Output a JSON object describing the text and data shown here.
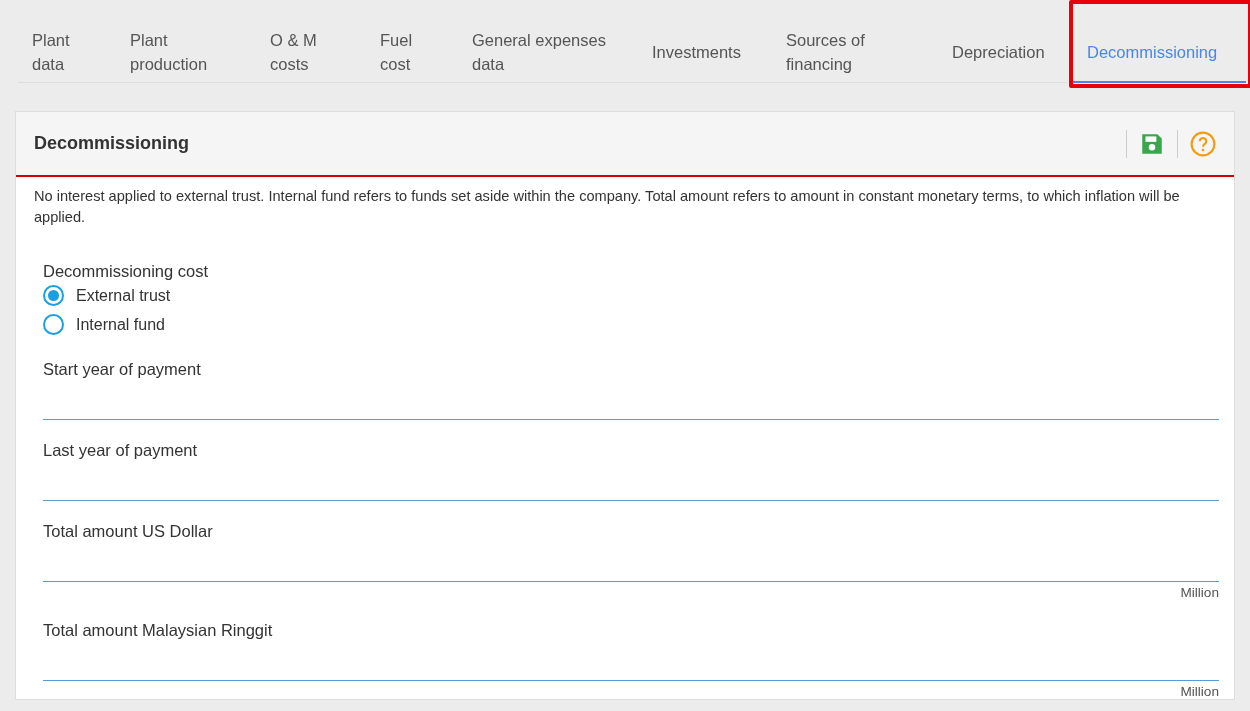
{
  "tabs": [
    {
      "label": "Plant data",
      "selected": false,
      "highlighted": false
    },
    {
      "label": "Plant production",
      "selected": false,
      "highlighted": false
    },
    {
      "label": "O & M costs",
      "selected": false,
      "highlighted": false
    },
    {
      "label": "Fuel cost",
      "selected": false,
      "highlighted": false
    },
    {
      "label": "General expenses data",
      "selected": false,
      "highlighted": false
    },
    {
      "label": "Investments",
      "selected": false,
      "highlighted": false
    },
    {
      "label": "Sources of financing",
      "selected": false,
      "highlighted": false
    },
    {
      "label": "Depreciation",
      "selected": false,
      "highlighted": false
    },
    {
      "label": "Decommissioning",
      "selected": true,
      "highlighted": true
    }
  ],
  "panel": {
    "title": "Decommissioning",
    "description": "No interest applied to external trust. Internal fund refers to funds set aside within the company. Total amount refers to amount in constant monetary terms, to which inflation will be applied.",
    "radio_group": {
      "label": "Decommissioning cost",
      "options": [
        {
          "label": "External trust",
          "selected": true
        },
        {
          "label": "Internal fund",
          "selected": false
        }
      ]
    },
    "fields": [
      {
        "label": "Start year of payment"
      },
      {
        "label": "Last year of payment"
      },
      {
        "label": "Total amount US Dollar",
        "unit": "Million"
      },
      {
        "label": "Total amount Malaysian Ringgit",
        "unit": "Million"
      }
    ]
  }
}
